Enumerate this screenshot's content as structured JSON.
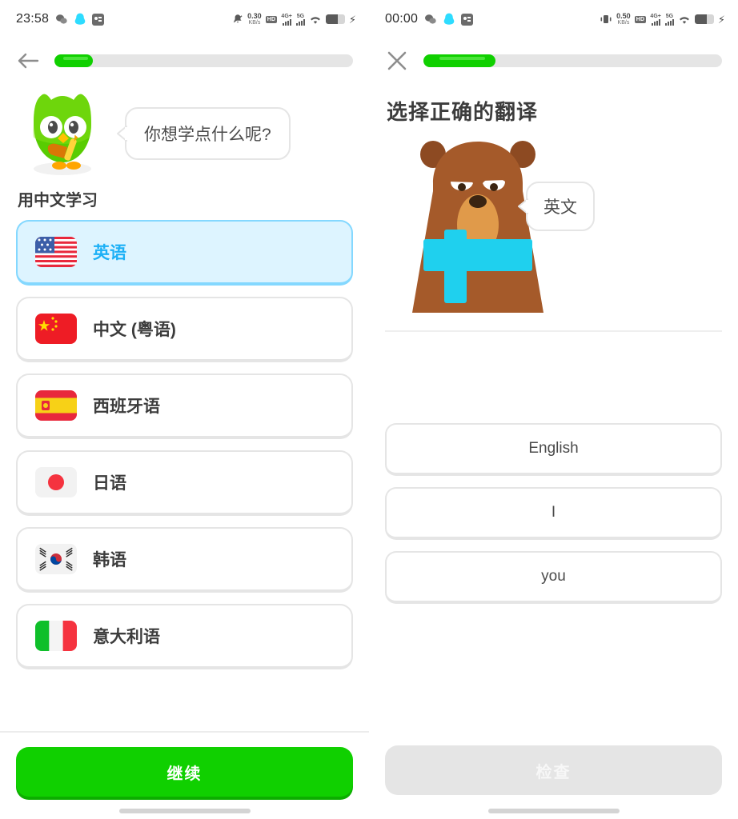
{
  "colors": {
    "brand_green": "#10d000",
    "brand_green_shadow": "#0cae00",
    "accent_blue": "#1cb0f6",
    "selected_bg": "#ddf4ff",
    "selected_border": "#84d8ff",
    "text_dark": "#3c3c3c",
    "text_body": "#4b4b4b",
    "border_gray": "#e5e5e5",
    "disabled_bg": "#e5e5e5",
    "bear_brown": "#a55a2a",
    "bear_scarf": "#1fd0ee"
  },
  "left_panel": {
    "status_bar": {
      "time": "23:58",
      "left_icons": [
        "wechat-icon",
        "qq-icon",
        "app-icon"
      ],
      "network_speed_value": "0.30",
      "network_speed_unit": "KB/s",
      "hd_badge": "HD",
      "hd_sub": "2",
      "hd_sup": "1",
      "signal_1_label": "4G+",
      "signal_2_label": "5G",
      "right_icons": [
        "mute-bell-icon",
        "wifi-icon",
        "battery-icon",
        "charging-bolt-icon"
      ]
    },
    "nav": {
      "back_icon": "back-arrow-icon"
    },
    "progress": {
      "percent": 13
    },
    "mascot": {
      "name": "duo-owl",
      "bubble_text": "你想学点什么呢?"
    },
    "section_title": "用中文学习",
    "languages": [
      {
        "label": "英语",
        "flag": "us-flag",
        "selected": true
      },
      {
        "label": "中文 (粤语)",
        "flag": "cn-flag",
        "selected": false
      },
      {
        "label": "西班牙语",
        "flag": "es-flag",
        "selected": false
      },
      {
        "label": "日语",
        "flag": "jp-flag",
        "selected": false
      },
      {
        "label": "韩语",
        "flag": "kr-flag",
        "selected": false
      },
      {
        "label": "意大利语",
        "flag": "it-flag",
        "selected": false
      }
    ],
    "cta_label": "继续"
  },
  "right_panel": {
    "status_bar": {
      "time": "00:00",
      "left_icons": [
        "wechat-icon",
        "qq-icon",
        "app-icon"
      ],
      "network_speed_value": "0.50",
      "network_speed_unit": "KB/s",
      "hd_badge": "HD",
      "hd_sub": "2",
      "hd_sup": "1",
      "signal_1_label": "4G+",
      "signal_2_label": "5G",
      "right_icons": [
        "vibrate-icon",
        "wifi-icon",
        "battery-icon",
        "charging-bolt-icon"
      ]
    },
    "nav": {
      "close_icon": "close-x-icon"
    },
    "progress": {
      "percent": 24
    },
    "title": "选择正确的翻译",
    "mascot": {
      "name": "falstaff-bear",
      "bubble_text": "英文"
    },
    "choices": [
      {
        "label": "English"
      },
      {
        "label": "I"
      },
      {
        "label": "you"
      }
    ],
    "cta_label": "检查",
    "cta_disabled": true
  }
}
